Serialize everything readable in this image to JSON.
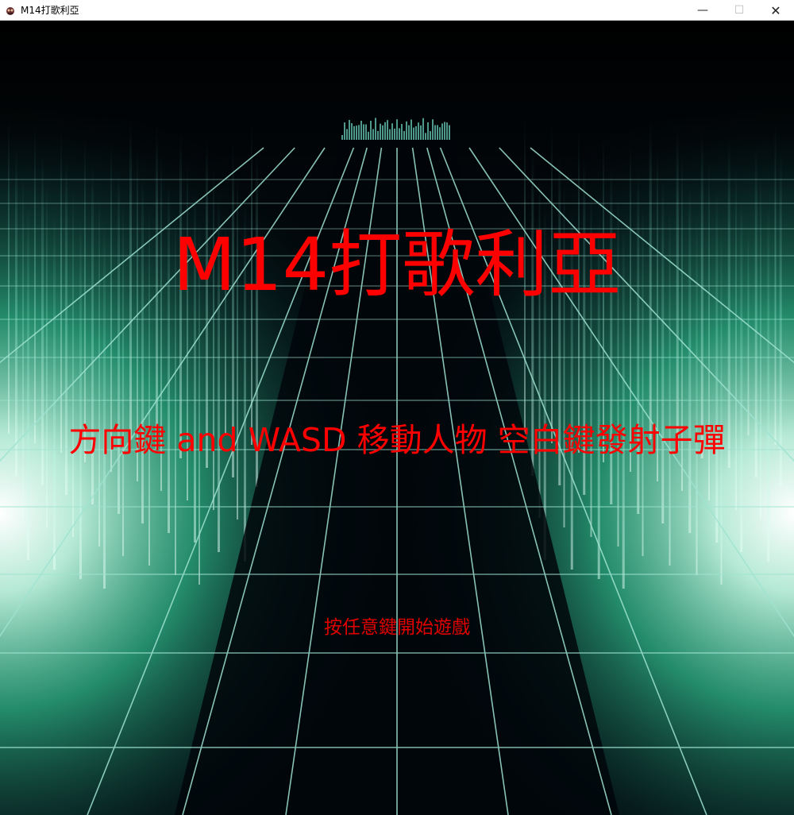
{
  "window": {
    "title": "M14打歌利亞",
    "icon": "app-logo-icon",
    "controls": {
      "minimize": "—",
      "maximize": "☐",
      "close": "✕"
    }
  },
  "screen": {
    "game_title": "M14打歌利亞",
    "instructions": "方向鍵 and WASD 移動人物 空白鍵發射子彈",
    "start_prompt": "按任意鍵開始遊戲"
  },
  "colors": {
    "text": "#ff0000",
    "grid": "#8fd6c8",
    "glow": "#3fe0b0"
  }
}
